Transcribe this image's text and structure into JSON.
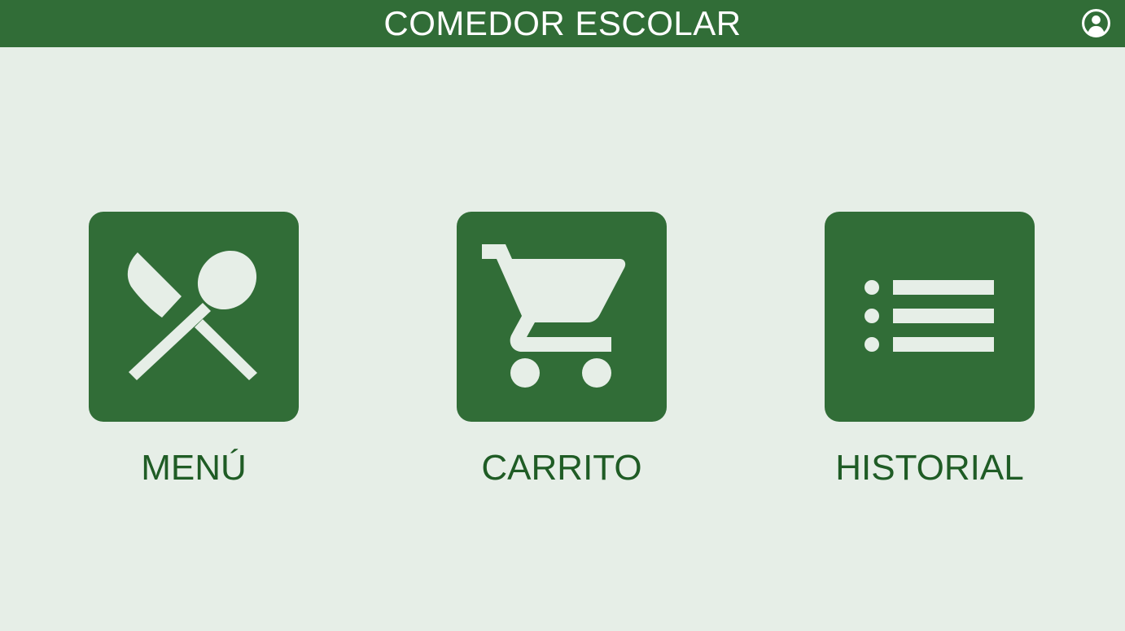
{
  "header": {
    "title": "COMEDOR ESCOLAR",
    "account_icon": "account-circle-icon"
  },
  "tiles": [
    {
      "label": "MENÚ",
      "icon": "fork-spoon-icon"
    },
    {
      "label": "CARRITO",
      "icon": "shopping-cart-icon"
    },
    {
      "label": "HISTORIAL",
      "icon": "list-icon"
    }
  ],
  "colors": {
    "primary": "#316d37",
    "background": "#e6eee7",
    "icon_fill": "#e6eee7",
    "label_text": "#1f5c25",
    "header_text": "#ffffff"
  }
}
